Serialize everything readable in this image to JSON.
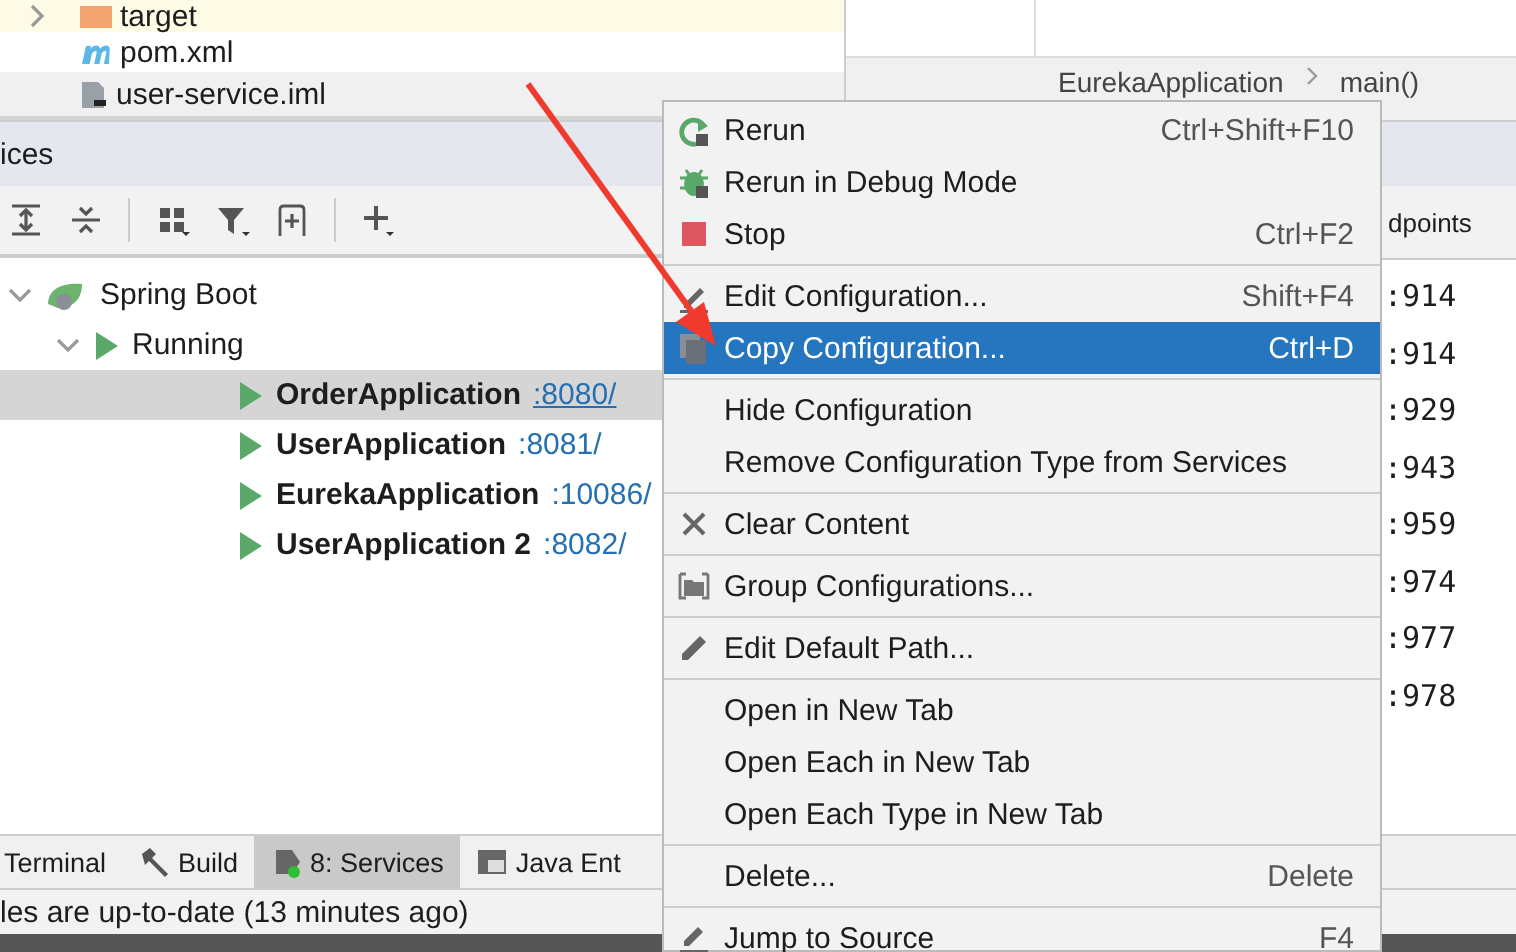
{
  "project_tree": [
    {
      "label": "target",
      "kind": "excluded-folder",
      "expanded": false
    },
    {
      "label": "pom.xml",
      "kind": "maven"
    },
    {
      "label": "user-service.iml",
      "kind": "module"
    }
  ],
  "editor": {
    "breadcrumb": [
      "EurekaApplication",
      "main()"
    ]
  },
  "services": {
    "title": "ices",
    "tree": [
      {
        "label": "Spring Boot",
        "kind": "spring",
        "expanded": true,
        "children": [
          {
            "label": "Running",
            "kind": "run",
            "expanded": true,
            "children": [
              {
                "label": "OrderApplication",
                "port": ":8080/",
                "selected": true
              },
              {
                "label": "UserApplication",
                "port": ":8081/",
                "selected": false
              },
              {
                "label": "EurekaApplication",
                "port": ":10086/",
                "selected": false
              },
              {
                "label": "UserApplication 2",
                "port": ":8082/",
                "selected": false
              }
            ]
          }
        ]
      }
    ]
  },
  "side_panel": {
    "tab": "dpoints",
    "lines": [
      ":914",
      ":914",
      ":929",
      ":943",
      ":959",
      ":974",
      ":977",
      ":978"
    ]
  },
  "context_menu": [
    {
      "kind": "rerun",
      "label": "Rerun",
      "shortcut": "Ctrl+Shift+F10",
      "selected": false
    },
    {
      "kind": "debug",
      "label": "Rerun in Debug Mode",
      "selected": false
    },
    {
      "kind": "stop",
      "label": "Stop",
      "shortcut": "Ctrl+F2",
      "selected": false
    },
    {
      "kind": "separator"
    },
    {
      "kind": "edit",
      "label": "Edit Configuration...",
      "shortcut": "Shift+F4",
      "selected": false
    },
    {
      "kind": "copy",
      "label": "Copy Configuration...",
      "shortcut": "Ctrl+D",
      "selected": true
    },
    {
      "kind": "separator"
    },
    {
      "kind": "plain",
      "label": "Hide Configuration",
      "selected": false
    },
    {
      "kind": "plain",
      "label": "Remove Configuration Type from Services",
      "selected": false
    },
    {
      "kind": "separator"
    },
    {
      "kind": "clear",
      "label": "Clear Content",
      "selected": false
    },
    {
      "kind": "separator"
    },
    {
      "kind": "group",
      "label": "Group Configurations...",
      "selected": false
    },
    {
      "kind": "separator"
    },
    {
      "kind": "path",
      "label": "Edit Default Path...",
      "selected": false
    },
    {
      "kind": "separator"
    },
    {
      "kind": "plain",
      "label": "Open in New Tab",
      "selected": false
    },
    {
      "kind": "plain",
      "label": "Open Each in New Tab",
      "selected": false
    },
    {
      "kind": "plain",
      "label": "Open Each Type in New Tab",
      "selected": false
    },
    {
      "kind": "separator"
    },
    {
      "kind": "plain",
      "label": "Delete...",
      "shortcut": "Delete",
      "selected": false
    },
    {
      "kind": "separator"
    },
    {
      "kind": "jump",
      "label": "Jump to Source",
      "shortcut": "F4",
      "selected": false
    }
  ],
  "tool_tabs": [
    {
      "label": "Terminal",
      "kind": "plain",
      "selected": false
    },
    {
      "label": "Build",
      "kind": "build",
      "selected": false
    },
    {
      "label": "8: Services",
      "kind": "services",
      "selected": true
    },
    {
      "label": "Java Ent",
      "kind": "java-ee",
      "selected": false
    }
  ],
  "status_bar": "les are up-to-date (13 minutes ago)"
}
